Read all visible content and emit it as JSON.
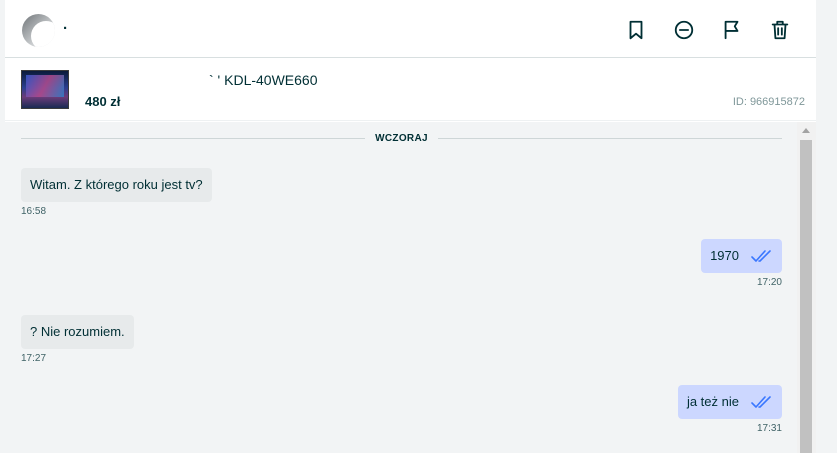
{
  "header": {
    "username": "·",
    "actions": [
      {
        "name": "bookmark-icon"
      },
      {
        "name": "block-icon"
      },
      {
        "name": "flag-icon"
      },
      {
        "name": "trash-icon"
      }
    ]
  },
  "listing": {
    "title": "` ' KDL-40WE660",
    "price": "480 zł",
    "id": "ID: 966915872"
  },
  "chat": {
    "day_label": "WCZORAJ",
    "messages": [
      {
        "direction": "in",
        "text": "Witam. Z którego roku jest tv?",
        "time": "16:58"
      },
      {
        "direction": "out",
        "text": "1970",
        "time": "17:20",
        "read": true
      },
      {
        "direction": "in",
        "text": "? Nie rozumiem.",
        "time": "17:27"
      },
      {
        "direction": "out",
        "text": "ja też nie",
        "time": "17:31",
        "read": true
      }
    ]
  },
  "colors": {
    "text": "#002f34",
    "incoming_bubble": "#e7eaeb",
    "outgoing_bubble": "#ccd7ff",
    "read_ticks": "#3a77ff"
  }
}
